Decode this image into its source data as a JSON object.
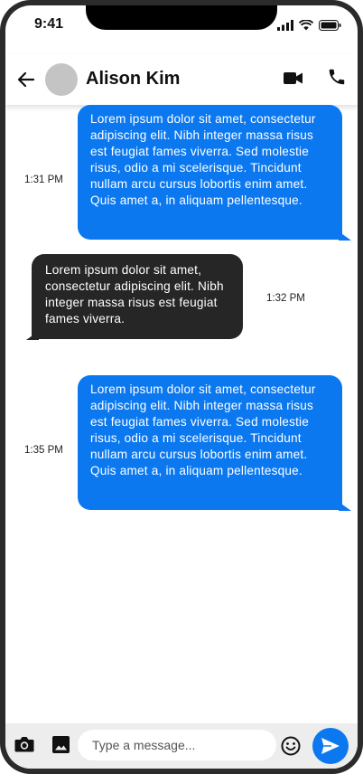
{
  "status_bar": {
    "time": "9:41"
  },
  "header": {
    "contact_name": "Alison Kim"
  },
  "messages": [
    {
      "direction": "outgoing",
      "text": "Lorem ipsum dolor sit amet, consectetur adipiscing elit. Nibh integer massa risus est feugiat fames viverra. Sed molestie risus, odio a mi scelerisque. Tincidunt nullam arcu cursus lobortis enim amet. Quis amet a, in aliquam pellentesque.",
      "time": "1:31 PM"
    },
    {
      "direction": "incoming",
      "text": "Lorem ipsum dolor sit amet, consectetur adipiscing elit. Nibh integer massa risus est feugiat fames viverra.",
      "time": "1:32 PM"
    },
    {
      "direction": "outgoing",
      "text": "Lorem ipsum dolor sit amet, consectetur adipiscing elit. Nibh integer massa risus est feugiat fames viverra. Sed molestie risus, odio a mi scelerisque. Tincidunt nullam arcu cursus lobortis enim amet. Quis amet a, in aliquam pellentesque.",
      "time": "1:35 PM"
    }
  ],
  "composer": {
    "placeholder": "Type a message..."
  },
  "colors": {
    "accent": "#0b78f0",
    "incoming_bubble": "#262626",
    "composer_bg": "#ededed"
  },
  "icons": {
    "back": "arrow-left-icon",
    "video": "video-camera-icon",
    "phone": "phone-icon",
    "camera": "camera-icon",
    "gallery": "image-icon",
    "emoji": "smiley-icon",
    "send": "send-icon"
  }
}
